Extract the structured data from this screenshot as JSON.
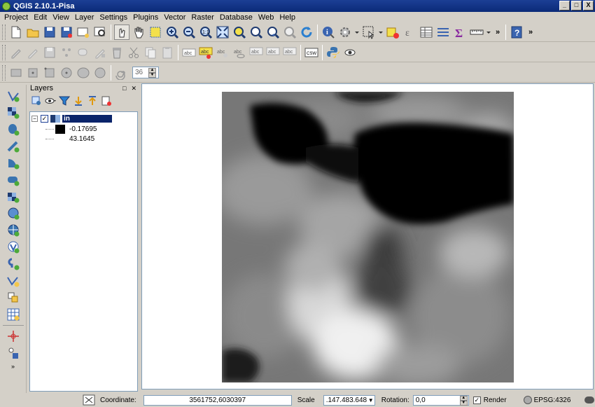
{
  "window": {
    "title": "QGIS 2.10.1-Pisa"
  },
  "menu": [
    "Project",
    "Edit",
    "View",
    "Layer",
    "Settings",
    "Plugins",
    "Vector",
    "Raster",
    "Database",
    "Web",
    "Help"
  ],
  "window_buttons": [
    "_",
    "□",
    "X"
  ],
  "toolbar_overflow": "»",
  "label_toolbar": {
    "csw_label": "CSW",
    "abc_label": "abc"
  },
  "rotation_spin": {
    "value": "36"
  },
  "layers_panel": {
    "title": "Layers",
    "float_icon": "□",
    "close_icon": "✕",
    "tree": [
      {
        "name": "in",
        "checked": true,
        "expanded": true,
        "legend": [
          "-0.17695",
          "43.1645"
        ]
      }
    ]
  },
  "status": {
    "coordinate_label": "Coordinate:",
    "coordinate_value": "3561752,6030397",
    "scale_label": "Scale",
    "scale_value": ".147.483.648",
    "rotation_label": "Rotation:",
    "rotation_value": "0,0",
    "render_label": "Render",
    "render_checked": true,
    "crs_label": "EPSG:4326"
  },
  "colors": {
    "title_bar": "#0a2a78",
    "selection": "#0a246a",
    "panel_bg": "#d4d0c8"
  }
}
